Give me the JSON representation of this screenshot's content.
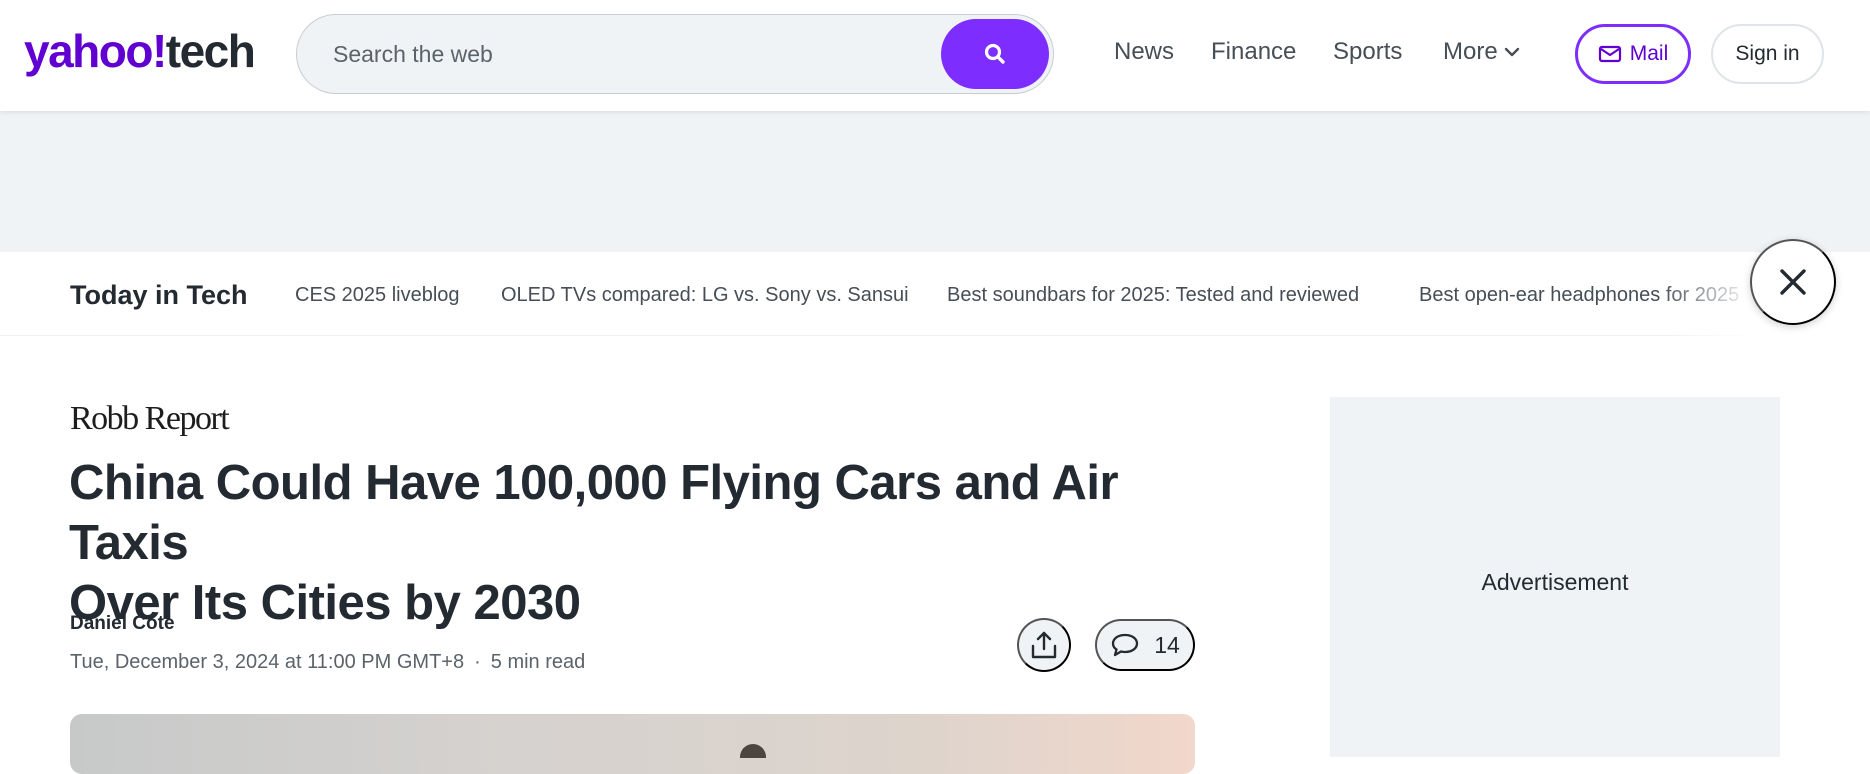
{
  "logo": {
    "brand": "yahoo!",
    "section": "tech"
  },
  "search": {
    "placeholder": "Search the web"
  },
  "nav": {
    "items": [
      "News",
      "Finance",
      "Sports"
    ],
    "more_label": "More"
  },
  "account": {
    "mail_label": "Mail",
    "signin_label": "Sign in"
  },
  "trending": {
    "title": "Today in Tech",
    "links": [
      "CES 2025 liveblog",
      "OLED TVs compared: LG vs. Sony vs. Sansui",
      "Best soundbars for 2025: Tested and reviewed",
      "Best open-ear headphones for 2025"
    ]
  },
  "article": {
    "publisher": "Robb Report",
    "headline_line1": "China Could Have 100,000 Flying Cars and Air Taxis",
    "headline_line2": "Over Its Cities by 2030",
    "author": "Daniel Cote",
    "date": "Tue, December 3, 2024 at 11:00 PM GMT+8",
    "separator": "·",
    "read_time": "5 min read",
    "comment_count": "14"
  },
  "sidebar": {
    "ad_label": "Advertisement"
  },
  "colors": {
    "brand_purple": "#6001d2",
    "accent": "#7d2eff",
    "text": "#232a31",
    "muted": "#5b636a",
    "panel": "#f0f3f5"
  },
  "icons": [
    "search-icon",
    "chevron-down-icon",
    "mail-icon",
    "close-icon",
    "share-icon",
    "comment-icon"
  ]
}
